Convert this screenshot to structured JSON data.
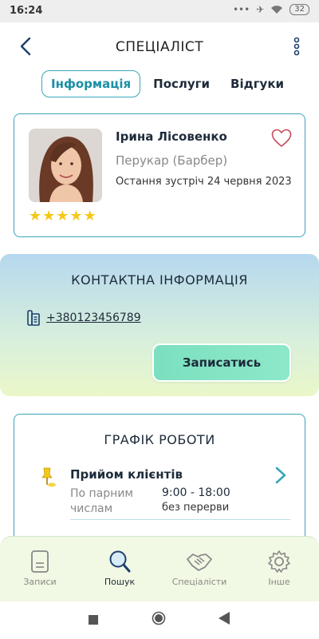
{
  "status_bar": {
    "time": "16:24",
    "icons": [
      "dots-icon",
      "airplane-icon",
      "wifi-icon"
    ],
    "battery": "32"
  },
  "header": {
    "title": "СПЕЦІАЛІСТ"
  },
  "tabs": [
    {
      "label": "Інформація",
      "active": true
    },
    {
      "label": "Послуги",
      "active": false
    },
    {
      "label": "Відгуки",
      "active": false
    }
  ],
  "profile": {
    "name": "Ірина Лісовенко",
    "role": "Перукар (Барбер)",
    "last_meeting": "Остання зустріч 24 червня 2023",
    "rating": 5,
    "rating_max": 5,
    "favorite": false
  },
  "contact": {
    "title": "КОНТАКТНА ІНФОРМАЦІЯ",
    "phone": "+380123456789",
    "book_button": "Записатись"
  },
  "schedule": {
    "title": "ГРАФІК РОБОТИ",
    "heading": "Прийом клієнтів",
    "days": "По парним числам",
    "hours": "9:00 - 18:00",
    "break": "без перерви"
  },
  "bottom_nav": [
    {
      "label": "Записи",
      "icon": "records-icon",
      "active": false
    },
    {
      "label": "Пошук",
      "icon": "search-icon",
      "active": true
    },
    {
      "label": "Спеціалісти",
      "icon": "handshake-icon",
      "active": false
    },
    {
      "label": "Інше",
      "icon": "gear-icon",
      "active": false
    }
  ],
  "colors": {
    "accent": "#3aa6b9",
    "star": "#f4c81a",
    "button": "#7be0c0",
    "heart": "#c84a5a"
  }
}
